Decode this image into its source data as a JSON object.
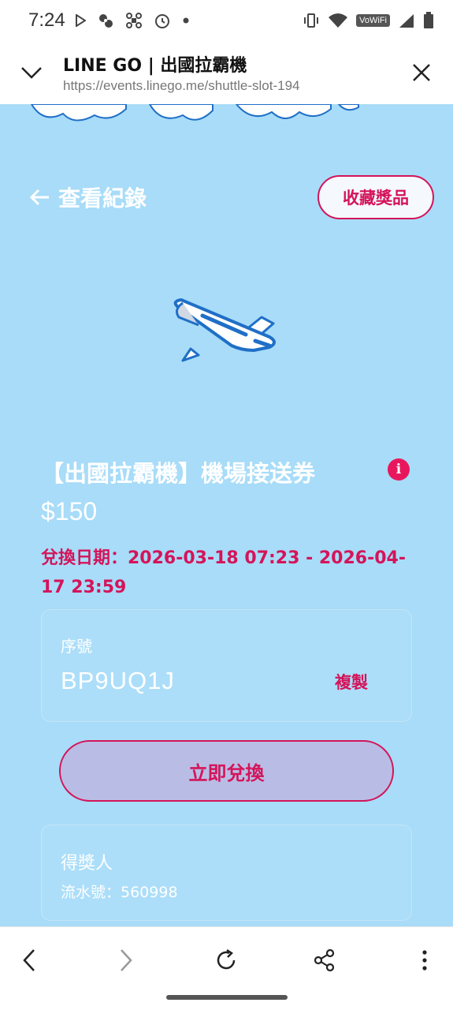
{
  "status_bar": {
    "time": "7:24",
    "vowifi_label": "VoWiFi"
  },
  "browser": {
    "title": "LINE GO | 出國拉霸機",
    "url": "https://events.linego.me/shuttle-slot-194"
  },
  "page": {
    "back_label": "查看紀錄",
    "favorites_label": "收藏獎品",
    "prize_title": "【出國拉霸機】機場接送券",
    "info_symbol": "i",
    "price": "$150",
    "redeem_period": "兌換日期：2026-03-18 07:23 - 2026-04-17 23:59",
    "serial_label": "序號",
    "serial_value": "BP9UQ1J",
    "copy_label": "複製",
    "redeem_label": "立即兌換",
    "winner_label": "得獎人",
    "winner_serial": "流水號：560998"
  },
  "colors": {
    "background": "#a8dcf8",
    "accent": "#d4145a",
    "redeem_button_bg": "#b9bde5"
  }
}
